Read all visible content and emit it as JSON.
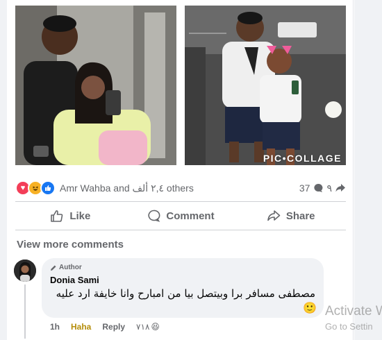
{
  "post": {
    "photos": [
      {
        "icon": "photo-elevator-selfie"
      },
      {
        "icon": "photo-costume-mirror-selfie",
        "watermark": "PIC•COLLAGE"
      }
    ],
    "reactions": {
      "icons": [
        "love-reaction-icon",
        "haha-reaction-icon",
        "like-reaction-icon"
      ],
      "names_text": "Amr Wahba and ٢,٤ ألف others",
      "comment_count": "37",
      "share_count": "٩"
    },
    "actions": {
      "like_label": "Like",
      "comment_label": "Comment",
      "share_label": "Share"
    }
  },
  "comments": {
    "view_more_label": "View more comments",
    "items": [
      {
        "author_badge": "Author",
        "name": "Donia Sami",
        "text": "مصطفى مسافر برا وبيتصل بيا من امبارح وانا خايفة ارد عليه",
        "emoji": "🙂",
        "time": "1h",
        "reacted_label": "Haha",
        "reply_label": "Reply",
        "reaction_count": "٧١٨",
        "reaction_emoji": "😆"
      }
    ]
  },
  "os_watermark": {
    "line1": "Activate W",
    "line2": "Go to Settin"
  },
  "colors": {
    "brand_blue": "#1877f2",
    "love_red": "#f33e58",
    "haha_yellow": "#f7b125",
    "secondary_text": "#65676b",
    "bubble_bg": "#f0f2f5"
  }
}
